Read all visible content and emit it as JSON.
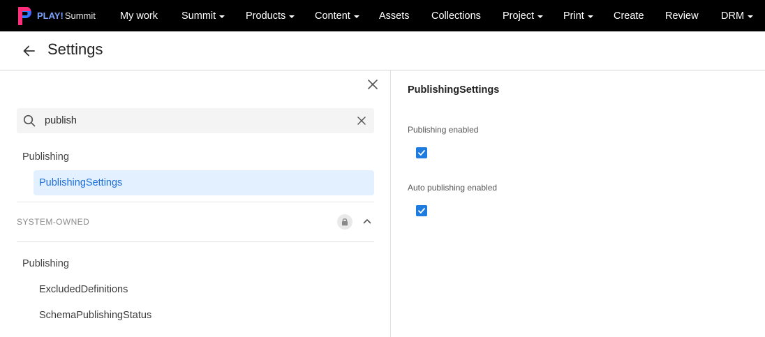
{
  "brand": {
    "logo": "play-logo-icon",
    "name_bold": "PLAY!",
    "name_light": "Summit",
    "accent_colors": [
      "#ff2d7a",
      "#7b3cff",
      "#2f7bff"
    ]
  },
  "nav": {
    "items": [
      {
        "label": "My work",
        "dropdown": false
      },
      {
        "label": "Summit",
        "dropdown": true
      },
      {
        "label": "Products",
        "dropdown": true
      },
      {
        "label": "Content",
        "dropdown": true
      },
      {
        "label": "Assets",
        "dropdown": false
      },
      {
        "label": "Collections",
        "dropdown": false
      },
      {
        "label": "Project",
        "dropdown": true
      },
      {
        "label": "Print",
        "dropdown": true
      },
      {
        "label": "Create",
        "dropdown": false
      },
      {
        "label": "Review",
        "dropdown": false
      },
      {
        "label": "DRM",
        "dropdown": true
      }
    ]
  },
  "header": {
    "back_icon": "arrow-left-icon",
    "title": "Settings"
  },
  "left_panel": {
    "close_icon": "close-icon",
    "search": {
      "value": "publish",
      "placeholder": "",
      "icon": "search-icon",
      "clear_icon": "clear-icon"
    },
    "groups": [
      {
        "label": "Publishing",
        "items": [
          {
            "label": "PublishingSettings",
            "selected": true
          }
        ]
      }
    ],
    "system_section": {
      "label": "SYSTEM-OWNED",
      "lock_icon": "lock-icon",
      "toggle_icon": "chevron-up-icon",
      "groups": [
        {
          "label": "Publishing",
          "items": [
            {
              "label": "ExcludedDefinitions",
              "selected": false
            },
            {
              "label": "SchemaPublishingStatus",
              "selected": false
            }
          ]
        }
      ]
    }
  },
  "detail": {
    "title": "PublishingSettings",
    "fields": [
      {
        "label": "Publishing enabled",
        "checked": true
      },
      {
        "label": "Auto publishing enabled",
        "checked": true
      }
    ]
  },
  "colors": {
    "nav_background": "#000000",
    "selected_background": "#e3f0ff",
    "selected_text": "#1e6fd9",
    "checkbox": "#1e7be0"
  }
}
